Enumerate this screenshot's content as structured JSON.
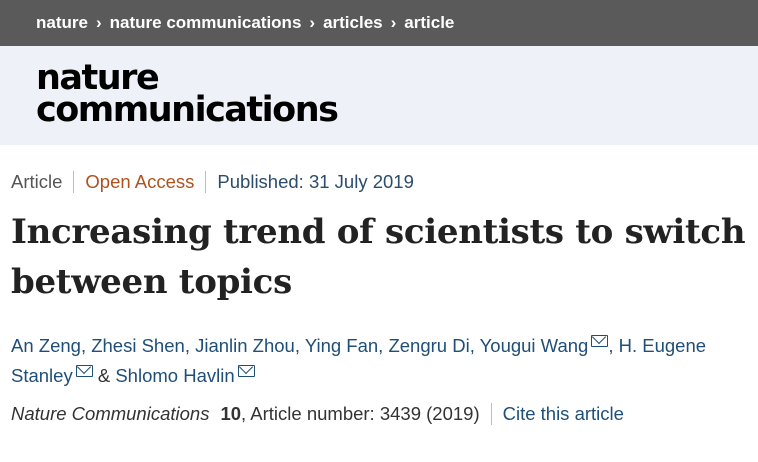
{
  "breadcrumb": {
    "items": [
      "nature",
      "nature communications",
      "articles",
      "article"
    ]
  },
  "masthead": {
    "logo_line1": "nature",
    "logo_line2": "communications"
  },
  "article": {
    "type": "Article",
    "access": "Open Access",
    "published": "Published: 31 July 2019",
    "title": "Increasing trend of scientists to switch between topics",
    "authors": [
      {
        "name": "An Zeng"
      },
      {
        "name": "Zhesi Shen"
      },
      {
        "name": "Jianlin Zhou"
      },
      {
        "name": "Ying Fan"
      },
      {
        "name": "Zengru Di"
      },
      {
        "name": "Yougui Wang"
      },
      {
        "name": "H. Eugene Stanley"
      },
      {
        "name": "Shlomo Havlin"
      }
    ],
    "amp": "&",
    "citation": {
      "journal": "Nature Communications",
      "volume": "10",
      "details": ", Article number: 3439 (2019)",
      "cite_link": "Cite this article"
    }
  },
  "icons": {
    "chevron": "chevron-right-icon",
    "mail": "mail-icon"
  },
  "colors": {
    "breadcrumb_bg": "#5a5a5a",
    "masthead_bg": "#eef2f8",
    "link": "#1f4e79",
    "open_access": "#b0521e"
  }
}
